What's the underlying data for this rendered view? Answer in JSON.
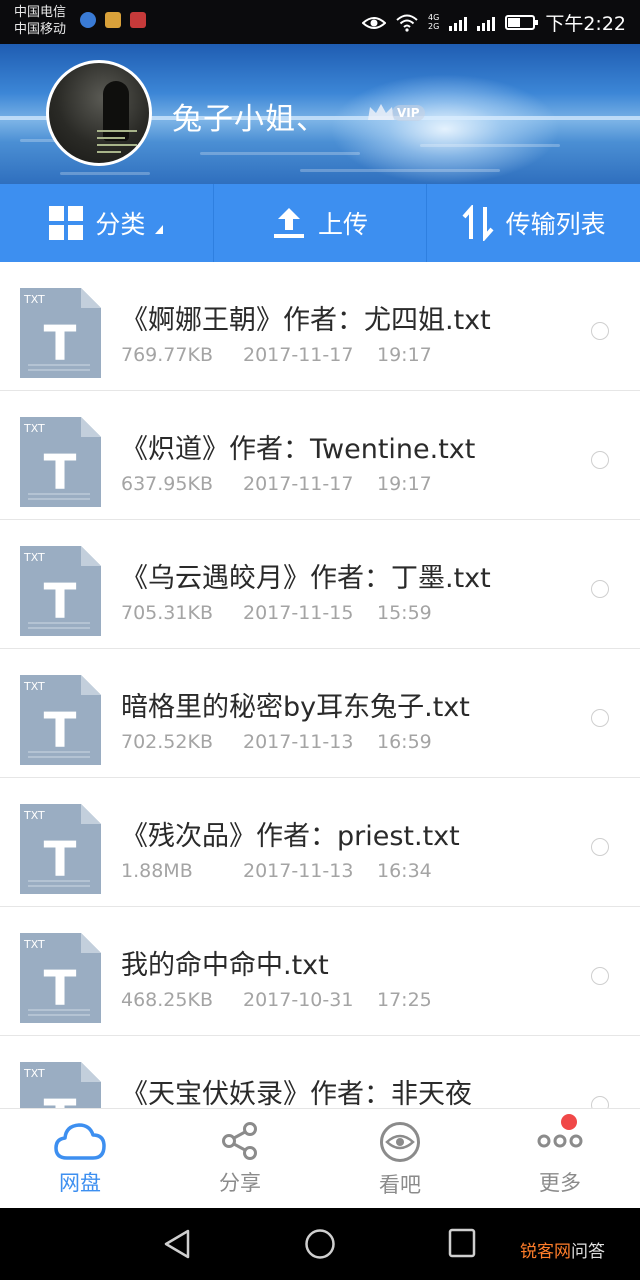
{
  "status_bar": {
    "carrier_1": "中国电信",
    "carrier_2": "中国移动",
    "network_1": "4G",
    "network_2": "2G",
    "clock": "下午2:22"
  },
  "profile": {
    "username": "兔子小姐、",
    "vip_badge": "VIP"
  },
  "toolbar": {
    "category_label": "分类",
    "upload_label": "上传",
    "transfer_label": "传输列表"
  },
  "files": [
    {
      "name": "《婀娜王朝》作者：尤四姐.txt",
      "size": "769.77KB",
      "date": "2017-11-17",
      "time": "19:17"
    },
    {
      "name": "《炽道》作者：Twentine.txt",
      "size": "637.95KB",
      "date": "2017-11-17",
      "time": "19:17"
    },
    {
      "name": "《乌云遇皎月》作者：丁墨.txt",
      "size": "705.31KB",
      "date": "2017-11-15",
      "time": "15:59"
    },
    {
      "name": "暗格里的秘密by耳东兔子.txt",
      "size": "702.52KB",
      "date": "2017-11-13",
      "time": "16:59"
    },
    {
      "name": "《残次品》作者：priest.txt",
      "size": "1.88MB",
      "date": "2017-11-13",
      "time": "16:34"
    },
    {
      "name": "我的命中命中.txt",
      "size": "468.25KB",
      "date": "2017-10-31",
      "time": "17:25"
    },
    {
      "name": "《天宝伏妖录》作者：非天夜",
      "size": "",
      "date": "",
      "time": ""
    }
  ],
  "file_icon_label": "TXT",
  "file_icon_letter": "T",
  "bottom_nav": {
    "items": [
      {
        "label": "网盘",
        "icon": "cloud-icon",
        "active": true
      },
      {
        "label": "分享",
        "icon": "share-icon",
        "active": false
      },
      {
        "label": "看吧",
        "icon": "eye-icon",
        "active": false
      },
      {
        "label": "更多",
        "icon": "more-icon",
        "active": false
      }
    ]
  },
  "watermark": {
    "brand": "锐客网",
    "suffix": "问答"
  },
  "colors": {
    "accent": "#3d8ff0",
    "file_icon": "#9aadc2",
    "badge": "#f04848"
  }
}
